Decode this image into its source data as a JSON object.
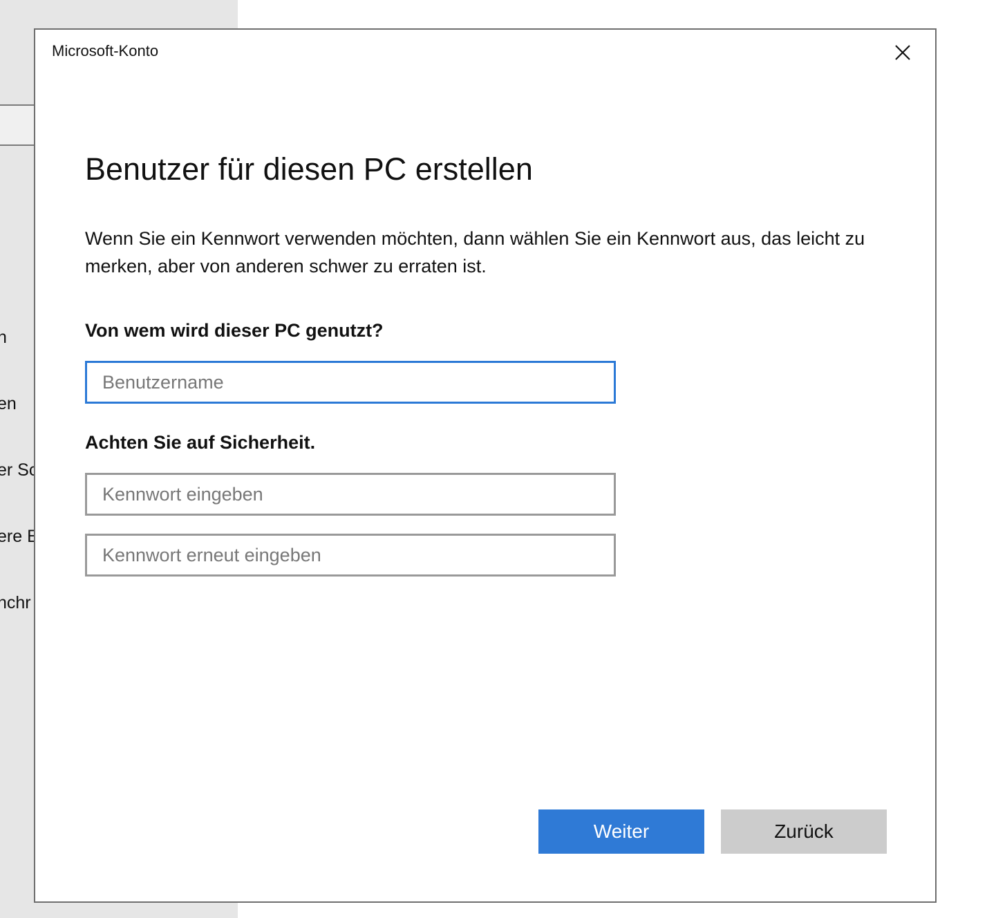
{
  "background": {
    "items": [
      "n",
      "en",
      "er Sc",
      "ere E",
      "nchr"
    ]
  },
  "dialog": {
    "title": "Microsoft-Konto",
    "heading": "Benutzer für diesen PC erstellen",
    "description": "Wenn Sie ein Kennwort verwenden möchten, dann wählen Sie ein Kennwort aus, das leicht zu merken, aber von anderen schwer zu erraten ist.",
    "user_label": "Von wem wird dieser PC genutzt?",
    "username_placeholder": "Benutzername",
    "username_value": "",
    "security_label": "Achten Sie auf Sicherheit.",
    "password_placeholder": "Kennwort eingeben",
    "password_value": "",
    "password_repeat_placeholder": "Kennwort erneut eingeben",
    "password_repeat_value": "",
    "next_label": "Weiter",
    "back_label": "Zurück"
  },
  "colors": {
    "accent": "#2f7ad6",
    "secondary_button": "#cccccc"
  }
}
